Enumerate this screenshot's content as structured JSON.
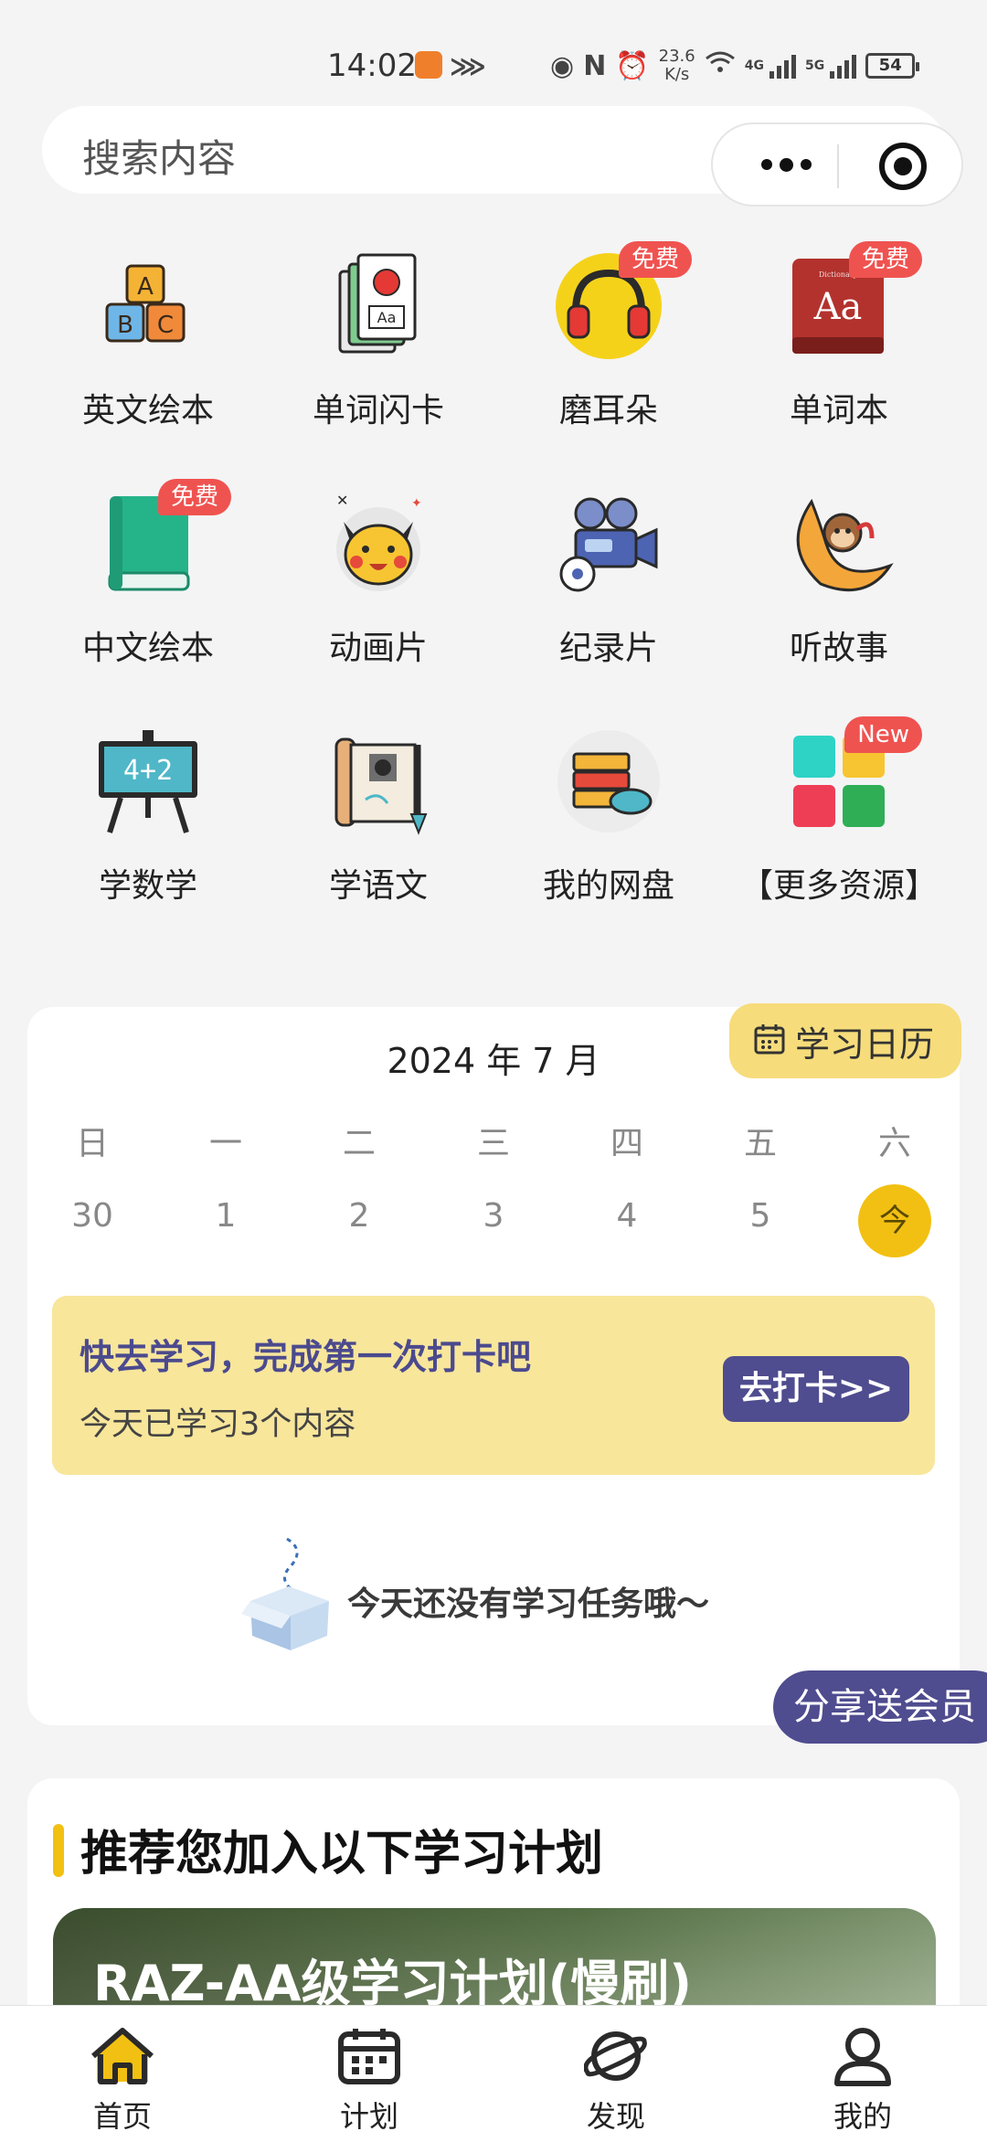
{
  "status_bar": {
    "time": "14:02",
    "speed_value": "23.6",
    "speed_unit": "K/s",
    "network_1": "4G",
    "network_2": "5G",
    "battery": "54"
  },
  "search": {
    "placeholder": "搜索内容"
  },
  "grid": {
    "items": [
      {
        "label": "英文绘本",
        "icon": "abc-blocks-icon"
      },
      {
        "label": "单词闪卡",
        "icon": "flashcards-icon"
      },
      {
        "label": "磨耳朵",
        "icon": "headphones-icon",
        "badge": "免费"
      },
      {
        "label": "单词本",
        "icon": "dictionary-icon",
        "badge": "免费"
      },
      {
        "label": "中文绘本",
        "icon": "green-book-icon",
        "badge": "免费"
      },
      {
        "label": "动画片",
        "icon": "pikachu-icon"
      },
      {
        "label": "纪录片",
        "icon": "film-camera-icon"
      },
      {
        "label": "听故事",
        "icon": "moon-monkey-icon"
      },
      {
        "label": "学数学",
        "icon": "math-board-icon"
      },
      {
        "label": "学语文",
        "icon": "scroll-brush-icon"
      },
      {
        "label": "我的网盘",
        "icon": "cloud-storage-icon"
      },
      {
        "label": "【更多资源】",
        "icon": "color-squares-icon",
        "badge": "New"
      }
    ]
  },
  "calendar": {
    "tag": "学习日历",
    "title": "2024 年 7 月",
    "weekdays": [
      "日",
      "一",
      "二",
      "三",
      "四",
      "五",
      "六"
    ],
    "dates": [
      "30",
      "1",
      "2",
      "3",
      "4",
      "5",
      "今"
    ],
    "today_index": 6
  },
  "checkin": {
    "title": "快去学习，完成第一次打卡吧",
    "subtitle": "今天已学习3个内容",
    "button": "去打卡>>"
  },
  "empty": {
    "text": "今天还没有学习任务哦～"
  },
  "share_button": "分享送会员",
  "recommend": {
    "title": "推荐您加入以下学习计划",
    "plan_title": "RAZ-AA级学习计划(慢刷)"
  },
  "tabs": [
    {
      "label": "首页",
      "icon": "home-icon",
      "active": true
    },
    {
      "label": "计划",
      "icon": "calendar-icon"
    },
    {
      "label": "发现",
      "icon": "planet-icon"
    },
    {
      "label": "我的",
      "icon": "user-icon"
    }
  ],
  "colors": {
    "accent_yellow": "#f2c012",
    "accent_purple": "#4f4c8f",
    "badge_red": "#ef5350",
    "checkin_bg": "#f8e69b"
  }
}
